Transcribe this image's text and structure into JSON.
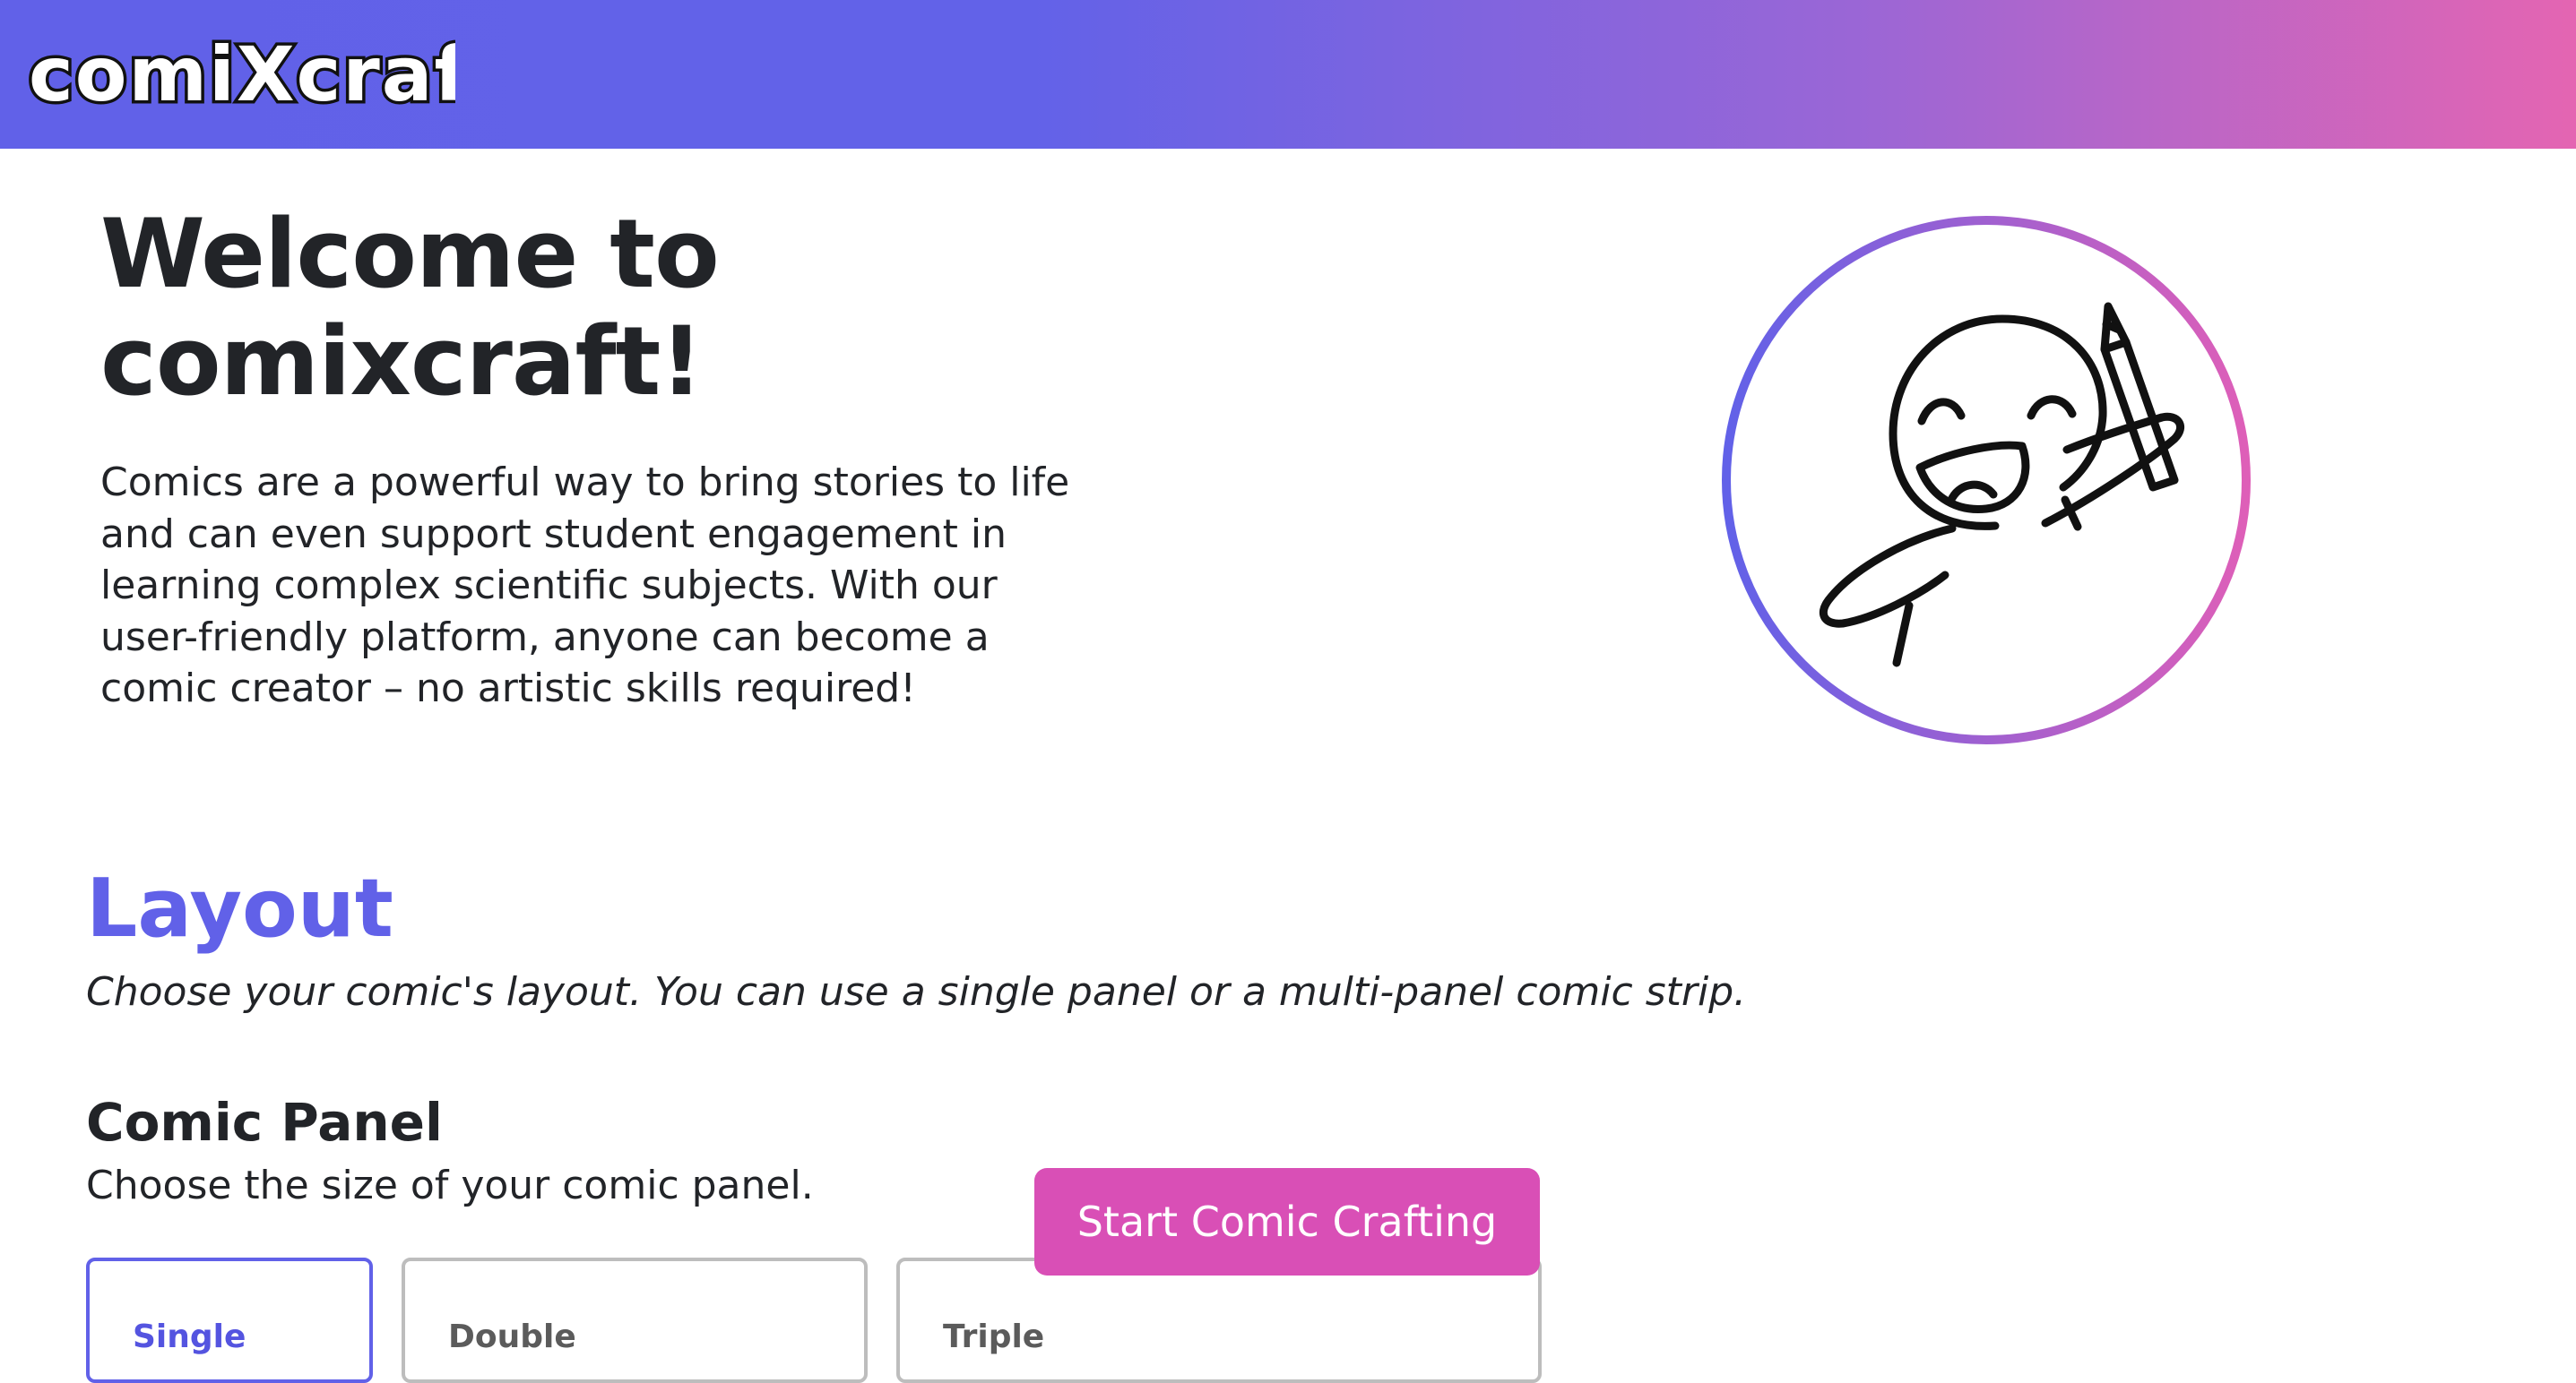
{
  "header": {
    "logo_text": "comiXcraft",
    "colors": {
      "gradient_start": "#6161e8",
      "gradient_end": "#e465b2"
    }
  },
  "hero": {
    "title": "Welcome to comixcraft!",
    "description": "Comics are a powerful way to bring stories to life and can even support student engagement in learning complex scientific subjects. With our user-friendly platform, anyone can become a comic creator – no artistic skills required!",
    "illustration": "mascot-drawing-with-pencil"
  },
  "layout": {
    "title": "Layout",
    "subtitle": "Choose your comic's layout. You can use a single panel or a multi-panel comic strip."
  },
  "comic_panel": {
    "title": "Comic Panel",
    "subtitle": "Choose the size of your comic panel.",
    "options": [
      {
        "label": "Single",
        "selected": true
      },
      {
        "label": "Double",
        "selected": false
      },
      {
        "label": "Triple",
        "selected": false
      }
    ]
  },
  "actions": {
    "start_label": "Start Comic Crafting"
  },
  "colors": {
    "accent": "#6161e8",
    "button": "#d94fb6",
    "text": "#222428"
  }
}
